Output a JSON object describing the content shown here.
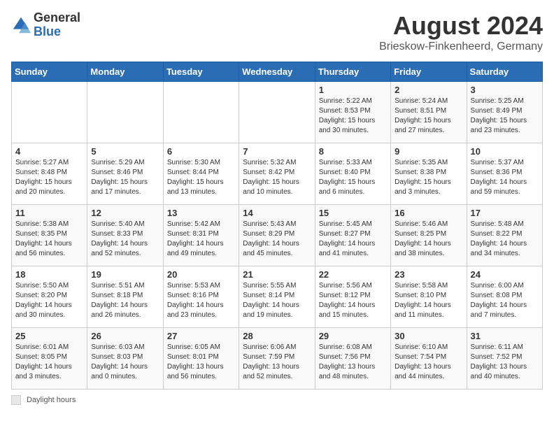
{
  "header": {
    "logo_general": "General",
    "logo_blue": "Blue",
    "month": "August 2024",
    "location": "Brieskow-Finkenheerd, Germany"
  },
  "weekdays": [
    "Sunday",
    "Monday",
    "Tuesday",
    "Wednesday",
    "Thursday",
    "Friday",
    "Saturday"
  ],
  "footer": {
    "note": "Daylight hours"
  },
  "weeks": [
    [
      {
        "day": "",
        "info": ""
      },
      {
        "day": "",
        "info": ""
      },
      {
        "day": "",
        "info": ""
      },
      {
        "day": "",
        "info": ""
      },
      {
        "day": "1",
        "info": "Sunrise: 5:22 AM\nSunset: 8:53 PM\nDaylight: 15 hours\nand 30 minutes."
      },
      {
        "day": "2",
        "info": "Sunrise: 5:24 AM\nSunset: 8:51 PM\nDaylight: 15 hours\nand 27 minutes."
      },
      {
        "day": "3",
        "info": "Sunrise: 5:25 AM\nSunset: 8:49 PM\nDaylight: 15 hours\nand 23 minutes."
      }
    ],
    [
      {
        "day": "4",
        "info": "Sunrise: 5:27 AM\nSunset: 8:48 PM\nDaylight: 15 hours\nand 20 minutes."
      },
      {
        "day": "5",
        "info": "Sunrise: 5:29 AM\nSunset: 8:46 PM\nDaylight: 15 hours\nand 17 minutes."
      },
      {
        "day": "6",
        "info": "Sunrise: 5:30 AM\nSunset: 8:44 PM\nDaylight: 15 hours\nand 13 minutes."
      },
      {
        "day": "7",
        "info": "Sunrise: 5:32 AM\nSunset: 8:42 PM\nDaylight: 15 hours\nand 10 minutes."
      },
      {
        "day": "8",
        "info": "Sunrise: 5:33 AM\nSunset: 8:40 PM\nDaylight: 15 hours\nand 6 minutes."
      },
      {
        "day": "9",
        "info": "Sunrise: 5:35 AM\nSunset: 8:38 PM\nDaylight: 15 hours\nand 3 minutes."
      },
      {
        "day": "10",
        "info": "Sunrise: 5:37 AM\nSunset: 8:36 PM\nDaylight: 14 hours\nand 59 minutes."
      }
    ],
    [
      {
        "day": "11",
        "info": "Sunrise: 5:38 AM\nSunset: 8:35 PM\nDaylight: 14 hours\nand 56 minutes."
      },
      {
        "day": "12",
        "info": "Sunrise: 5:40 AM\nSunset: 8:33 PM\nDaylight: 14 hours\nand 52 minutes."
      },
      {
        "day": "13",
        "info": "Sunrise: 5:42 AM\nSunset: 8:31 PM\nDaylight: 14 hours\nand 49 minutes."
      },
      {
        "day": "14",
        "info": "Sunrise: 5:43 AM\nSunset: 8:29 PM\nDaylight: 14 hours\nand 45 minutes."
      },
      {
        "day": "15",
        "info": "Sunrise: 5:45 AM\nSunset: 8:27 PM\nDaylight: 14 hours\nand 41 minutes."
      },
      {
        "day": "16",
        "info": "Sunrise: 5:46 AM\nSunset: 8:25 PM\nDaylight: 14 hours\nand 38 minutes."
      },
      {
        "day": "17",
        "info": "Sunrise: 5:48 AM\nSunset: 8:22 PM\nDaylight: 14 hours\nand 34 minutes."
      }
    ],
    [
      {
        "day": "18",
        "info": "Sunrise: 5:50 AM\nSunset: 8:20 PM\nDaylight: 14 hours\nand 30 minutes."
      },
      {
        "day": "19",
        "info": "Sunrise: 5:51 AM\nSunset: 8:18 PM\nDaylight: 14 hours\nand 26 minutes."
      },
      {
        "day": "20",
        "info": "Sunrise: 5:53 AM\nSunset: 8:16 PM\nDaylight: 14 hours\nand 23 minutes."
      },
      {
        "day": "21",
        "info": "Sunrise: 5:55 AM\nSunset: 8:14 PM\nDaylight: 14 hours\nand 19 minutes."
      },
      {
        "day": "22",
        "info": "Sunrise: 5:56 AM\nSunset: 8:12 PM\nDaylight: 14 hours\nand 15 minutes."
      },
      {
        "day": "23",
        "info": "Sunrise: 5:58 AM\nSunset: 8:10 PM\nDaylight: 14 hours\nand 11 minutes."
      },
      {
        "day": "24",
        "info": "Sunrise: 6:00 AM\nSunset: 8:08 PM\nDaylight: 14 hours\nand 7 minutes."
      }
    ],
    [
      {
        "day": "25",
        "info": "Sunrise: 6:01 AM\nSunset: 8:05 PM\nDaylight: 14 hours\nand 3 minutes."
      },
      {
        "day": "26",
        "info": "Sunrise: 6:03 AM\nSunset: 8:03 PM\nDaylight: 14 hours\nand 0 minutes."
      },
      {
        "day": "27",
        "info": "Sunrise: 6:05 AM\nSunset: 8:01 PM\nDaylight: 13 hours\nand 56 minutes."
      },
      {
        "day": "28",
        "info": "Sunrise: 6:06 AM\nSunset: 7:59 PM\nDaylight: 13 hours\nand 52 minutes."
      },
      {
        "day": "29",
        "info": "Sunrise: 6:08 AM\nSunset: 7:56 PM\nDaylight: 13 hours\nand 48 minutes."
      },
      {
        "day": "30",
        "info": "Sunrise: 6:10 AM\nSunset: 7:54 PM\nDaylight: 13 hours\nand 44 minutes."
      },
      {
        "day": "31",
        "info": "Sunrise: 6:11 AM\nSunset: 7:52 PM\nDaylight: 13 hours\nand 40 minutes."
      }
    ]
  ]
}
